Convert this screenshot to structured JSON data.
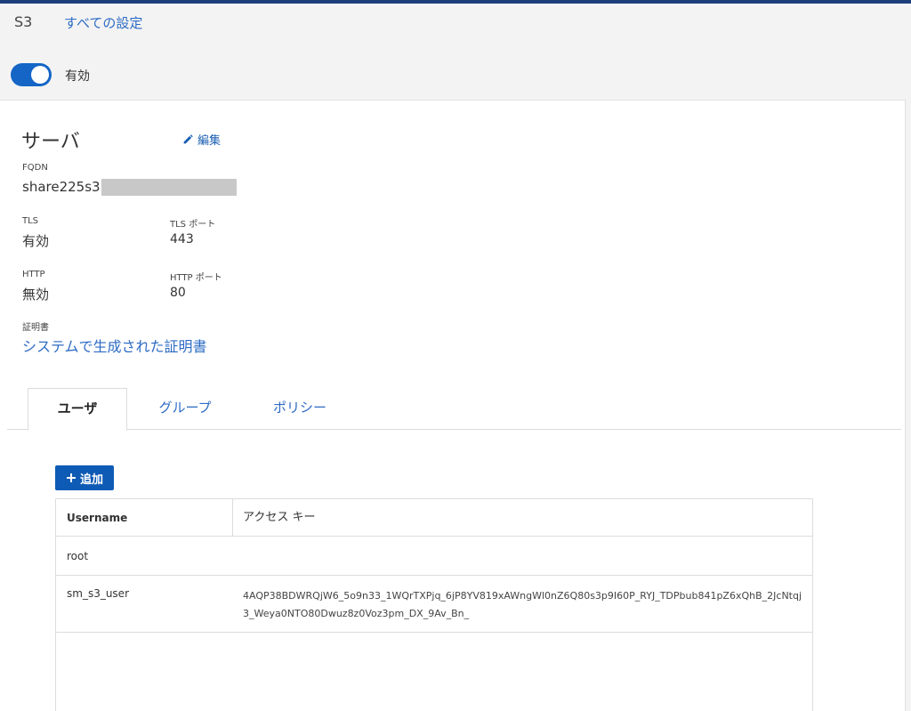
{
  "breadcrumb": {
    "service": "S3",
    "all_settings": "すべての設定"
  },
  "status": {
    "enabled": true,
    "label": "有効"
  },
  "server": {
    "title": "サーバ",
    "edit_label": "編集",
    "fqdn_label": "FQDN",
    "fqdn_value": "share225s3.",
    "tls_label": "TLS",
    "tls_value": "有効",
    "tls_port_label": "TLS ポート",
    "tls_port_value": "443",
    "http_label": "HTTP",
    "http_value": "無効",
    "http_port_label": "HTTP ポート",
    "http_port_value": "80",
    "cert_label": "証明書",
    "cert_value": "システムで生成された証明書"
  },
  "tabs": [
    {
      "label": "ユーザ",
      "active": true
    },
    {
      "label": "グループ",
      "active": false
    },
    {
      "label": "ポリシー",
      "active": false
    }
  ],
  "users": {
    "add_label": "追加",
    "columns": [
      "Username",
      "アクセス キー"
    ],
    "rows": [
      {
        "username": "root",
        "access_key": ""
      },
      {
        "username": "sm_s3_user",
        "access_key": "4AQP38BDWRQjW6_5o9n33_1WQrTXPjq_6jP8YV819xAWngWl0nZ6Q80s3p9I60P_RYJ_TDPbub841pZ6xQhB_2JcNtqj3_Weya0NTO80Dwuz8z0Voz3pm_DX_9Av_Bn_"
      }
    ]
  },
  "colors": {
    "accent": "#1465c6",
    "link": "#2d6bc4",
    "header_bar": "#1f3e7c"
  }
}
